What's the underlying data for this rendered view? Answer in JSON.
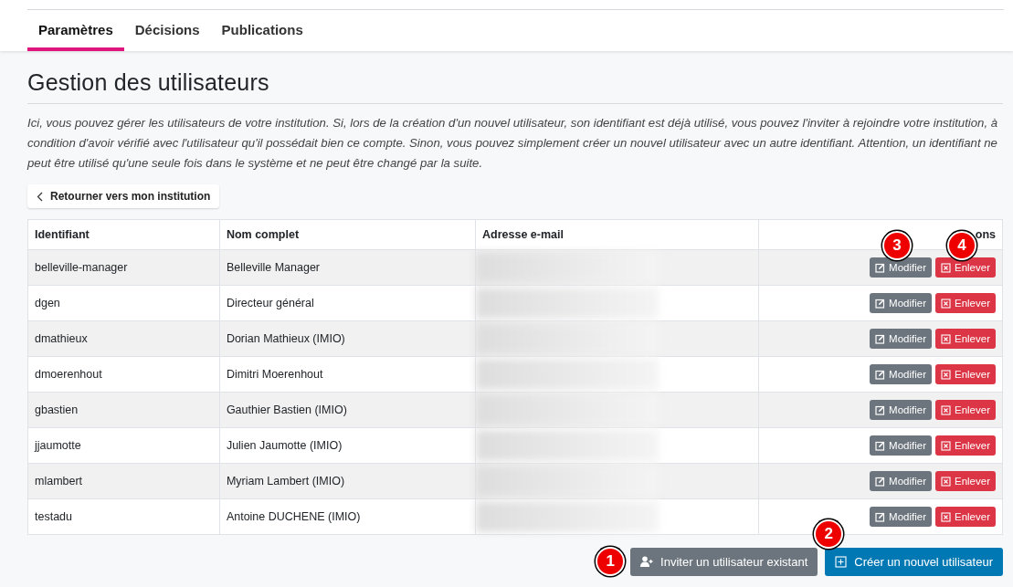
{
  "tabs": [
    {
      "label": "Paramètres",
      "selected": true
    },
    {
      "label": "Décisions",
      "selected": false
    },
    {
      "label": "Publications",
      "selected": false
    }
  ],
  "title": "Gestion des utilisateurs",
  "description": "Ici, vous pouvez gérer les utilisateurs de votre institution. Si, lors de la création d'un nouvel utilisateur, son identifiant est déjà utilisé, vous pouvez l'inviter à rejoindre votre institution, à condition d'avoir vérifié avec l'utilisateur qu'il possédait bien ce compte. Sinon, vous pouvez simplement créer un nouvel utilisateur avec un autre identifiant. Attention, un identifiant ne peut être utilisé qu'une seule fois dans le système et ne peut être changé par la suite.",
  "back_button": "Retourner vers mon institution",
  "table": {
    "columns": [
      "Identifiant",
      "Nom complet",
      "Adresse e-mail",
      "ons"
    ],
    "rows": [
      {
        "id": "belleville-manager",
        "name": "Belleville Manager",
        "edit": "Modifier",
        "remove": "Enlever"
      },
      {
        "id": "dgen",
        "name": "Directeur général",
        "edit": "Modifier",
        "remove": "Enlever"
      },
      {
        "id": "dmathieux",
        "name": "Dorian Mathieux (IMIO)",
        "edit": "Modifier",
        "remove": "Enlever"
      },
      {
        "id": "dmoerenhout",
        "name": "Dimitri Moerenhout",
        "edit": "Modifier",
        "remove": "Enlever"
      },
      {
        "id": "gbastien",
        "name": "Gauthier Bastien (IMIO)",
        "edit": "Modifier",
        "remove": "Enlever"
      },
      {
        "id": "jjaumotte",
        "name": "Julien Jaumotte (IMIO)",
        "edit": "Modifier",
        "remove": "Enlever"
      },
      {
        "id": "mlambert",
        "name": "Myriam Lambert (IMIO)",
        "edit": "Modifier",
        "remove": "Enlever"
      },
      {
        "id": "testadu",
        "name": "Antoine DUCHENE (IMIO)",
        "edit": "Modifier",
        "remove": "Enlever"
      }
    ]
  },
  "actions": [
    {
      "kind": "invite",
      "label": "Inviter un utilisateur existant"
    },
    {
      "kind": "create",
      "label": "Créer un nouvel utilisateur"
    }
  ],
  "callouts": [
    "1",
    "2",
    "3",
    "4"
  ]
}
